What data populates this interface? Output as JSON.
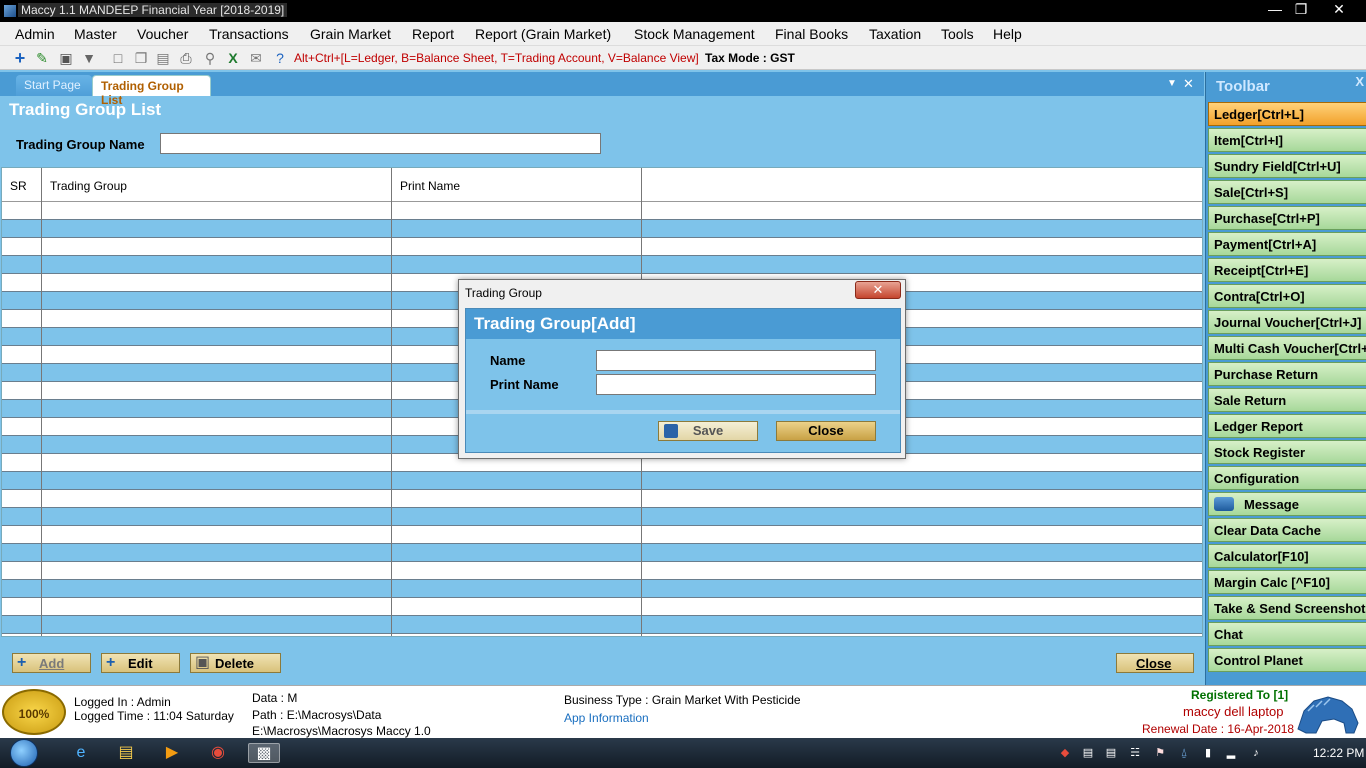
{
  "window": {
    "title": "Maccy 1.1 MANDEEP Financial Year [2018-2019]"
  },
  "menu": [
    "Admin",
    "Master",
    "Voucher",
    "Transactions",
    "Grain Market",
    "Report",
    "Report (Grain Market)",
    "Stock Management",
    "Final Books",
    "Taxation",
    "Tools",
    "Help"
  ],
  "toolstrip": {
    "shortcut_hint": "Alt+Ctrl+[L=Ledger, B=Balance Sheet, T=Trading Account, V=Balance View]",
    "tax_mode": "Tax Mode : GST"
  },
  "tabs": {
    "start_page": "Start Page",
    "active": "Trading Group List"
  },
  "list": {
    "title": "Trading Group List",
    "search_label": "Trading Group Name",
    "search_value": "",
    "columns": [
      "SR",
      "Trading Group",
      "Print Name"
    ]
  },
  "buttons": {
    "add": "Add",
    "edit": "Edit",
    "delete": "Delete",
    "close": "Close"
  },
  "right_toolbar": {
    "title": "Toolbar",
    "close": "X",
    "items": [
      "Ledger[Ctrl+L]",
      "Item[Ctrl+I]",
      "Sundry Field[Ctrl+U]",
      "Sale[Ctrl+S]",
      "Purchase[Ctrl+P]",
      "Payment[Ctrl+A]",
      "Receipt[Ctrl+E]",
      "Contra[Ctrl+O]",
      "Journal Voucher[Ctrl+J]",
      "Multi Cash Voucher[Ctrl+",
      "Purchase Return",
      "Sale Return",
      "Ledger Report",
      "Stock Register",
      "Configuration",
      "Message",
      "Clear Data Cache",
      "Calculator[F10]",
      "Margin Calc [^F10]",
      "Take & Send Screenshot",
      "Chat",
      "Control Planet"
    ]
  },
  "dialog": {
    "title": "Trading Group",
    "header": "Trading Group[Add]",
    "name_label": "Name",
    "name_value": "",
    "print_name_label": "Print Name",
    "print_name_value": "",
    "save": "Save",
    "close": "Close"
  },
  "status": {
    "seal_text": "100%",
    "logged_in": "Logged In : Admin",
    "logged_time": "Logged Time : 11:04 Saturday",
    "data": "Data : M",
    "path": "Path : E:\\Macrosys\\Data",
    "path2": "E:\\Macrosys\\Macrosys Maccy 1.0",
    "business_type": "Business Type : Grain Market With Pesticide",
    "app_info": "App Information",
    "registered_to": "Registered To [1]",
    "registered_name": "maccy dell laptop",
    "renewal": "Renewal Date : 16-Apr-2018"
  },
  "taskbar": {
    "clock": "12:22 PM"
  },
  "colors": {
    "panel_blue": "#7ec3ea",
    "header_blue": "#4a9bd4",
    "toolbar_green": "#a7d89a",
    "toolbar_highlight": "#f2a12b"
  }
}
